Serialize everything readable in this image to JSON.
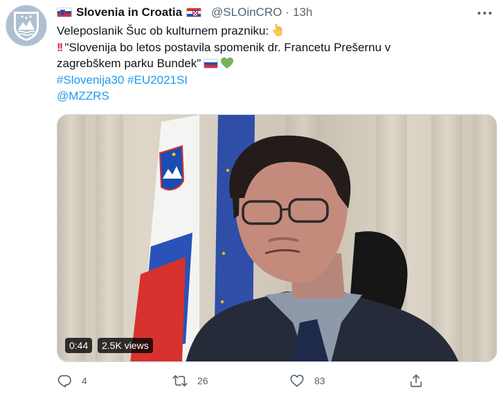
{
  "tweet": {
    "display_name": "Slovenia in Croatia",
    "handle": "@SLOinCRO",
    "separator": "·",
    "time": "13h",
    "text_line1": "Veleposlanik Šuc ob kulturnem prazniku:",
    "text_line2": "\"Slovenija bo letos postavila spomenik dr. Francetu Prešernu v",
    "text_line3": "zagrebškem parku Bundek\"",
    "hashtag1": "#Slovenija30",
    "hashtag2": "#EU2021SI",
    "mention": "@MZZRS"
  },
  "media": {
    "duration": "0:44",
    "views": "2.5K views"
  },
  "actions": {
    "replies": "4",
    "retweets": "26",
    "likes": "83"
  },
  "colors": {
    "link": "#1d9bf0",
    "secondary_text": "#536471",
    "heart_emoji": "#78b159",
    "exclamation_emoji": "#e0263e"
  },
  "icons": {
    "reply": "reply-icon",
    "retweet": "retweet-icon",
    "like": "heart-icon",
    "share": "share-icon",
    "more": "more-icon"
  }
}
